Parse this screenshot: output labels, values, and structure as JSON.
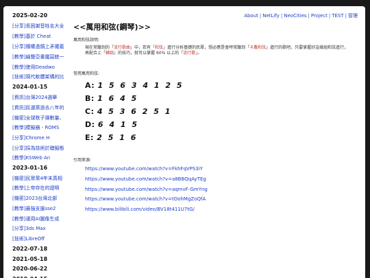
{
  "sidebar": {
    "groups": [
      {
        "date": "2025-02-20",
        "items": [
          {
            "label": "[分享]長困謝音姓名大全"
          },
          {
            "label": "[教學]基於 Cheat"
          },
          {
            "label": "[分享]隨權憑顏上矛擺義"
          },
          {
            "label": "[教學]繪聲亞書魔惡統一"
          },
          {
            "label": "[教學]使用Deadwo"
          },
          {
            "label": "[技術]現代軟體架構的比"
          }
        ]
      },
      {
        "date": "2024-01-15",
        "items": [
          {
            "label": "[資訊]台灣2024選舉"
          },
          {
            "label": "[資訊]民選黨過去八年的"
          },
          {
            "label": "[機密]全球秩子彈數量、"
          },
          {
            "label": "[教學]模擬器 - ROMS"
          },
          {
            "label": "[分享]Chrome H"
          },
          {
            "label": "[分享]採為技術於礎擬態"
          },
          {
            "label": "[教學]KSWeb An"
          }
        ]
      },
      {
        "date": "2023-01-16",
        "items": [
          {
            "label": "[機密]民眾黨4年末真相"
          },
          {
            "label": "[教學]上帝存在的證明"
          },
          {
            "label": "[機密]2023台灣北部"
          },
          {
            "label": "[教學]最強支援sse2"
          },
          {
            "label": "[教學]運用AI圖像生成"
          },
          {
            "label": "[分享]3ds Max"
          },
          {
            "label": "[技術]LibreOff"
          }
        ]
      },
      {
        "date": "2022-07-18",
        "items": []
      },
      {
        "date": "2021-05-18",
        "items": []
      },
      {
        "date": "2020-06-22",
        "items": []
      },
      {
        "date": "2019-04-15",
        "items": []
      }
    ]
  },
  "nav": {
    "items": [
      "About",
      "NetLify",
      "NeoCities",
      "Project",
      "TEST",
      "管理"
    ]
  },
  "main": {
    "title": "<<萬用和弦(鋼琴)>>",
    "intro_label": "萬用和弦說明:",
    "intro": {
      "p1": "現在常聽到的「",
      "l1": "流行歌曲",
      "p2": "」中，若有「",
      "l2": "和弦",
      "p3": "」進行分析基礎的民眾，想必應是會時常聽到「",
      "l3": "卡農和弦",
      "p4": "」進行的歌吧。只要掌握好這幾組和弦進行，再配合上「",
      "l4": "轉調",
      "p5": "」的技巧，就可以掌握 60% 以上的「",
      "l5": "流行歌",
      "p6": "」。"
    },
    "chords_label": "常用萬用和弦:",
    "chords": [
      {
        "name": "A:",
        "numbers": "1 5 6 3 4 1 2 5"
      },
      {
        "name": "B:",
        "numbers": "1 6 4 5"
      },
      {
        "name": "C:",
        "numbers": "4 5 3 6 2 5 1"
      },
      {
        "name": "D:",
        "numbers": "6 4 1 5"
      },
      {
        "name": "E:",
        "numbers": "2 5 1 6"
      }
    ],
    "refs_label": "引用來源:",
    "refs": [
      "https://www.youtube.com/watch?v=FkhFqVPS3iY",
      "https://www.youtube.com/watch?v=a8BBQqAyTEg",
      "https://www.youtube.com/watch?v=aqmvF-GmYng",
      "https://www.youtube.com/watch?v=tOohMgZoQfA",
      "https://www.bilibili.com/video/BV18t411U7tG/"
    ]
  }
}
